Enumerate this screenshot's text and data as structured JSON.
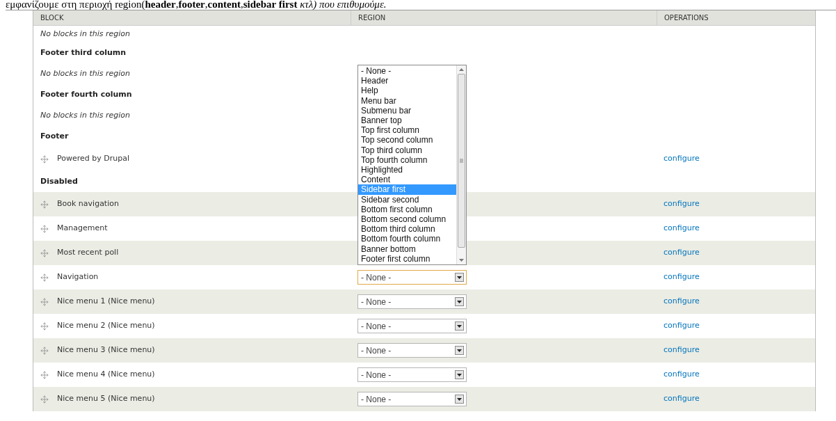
{
  "caption": "εμφανίζουμε στη περιοχή region(**header**,**footer**,**content**,**sidebar first** *κτλ) που επιθυμούμε.*",
  "table": {
    "columns": [
      "BLOCK",
      "REGION",
      "OPERATIONS"
    ],
    "rows": [
      {
        "kind": "empty",
        "text": "No blocks in this region"
      },
      {
        "kind": "region",
        "text": "Footer third column"
      },
      {
        "kind": "empty",
        "text": "No blocks in this region"
      },
      {
        "kind": "region",
        "text": "Footer fourth column"
      },
      {
        "kind": "empty",
        "text": "No blocks in this region"
      },
      {
        "kind": "region",
        "text": "Footer"
      },
      {
        "kind": "block",
        "name": "Powered by Drupal",
        "striped": false,
        "operation": "configure"
      },
      {
        "kind": "region",
        "text": "Disabled"
      },
      {
        "kind": "block",
        "name": "Book navigation",
        "striped": true,
        "operation": "configure"
      },
      {
        "kind": "block",
        "name": "Management",
        "striped": false,
        "operation": "configure"
      },
      {
        "kind": "block",
        "name": "Most recent poll",
        "striped": true,
        "operation": "configure"
      },
      {
        "kind": "block",
        "name": "Navigation",
        "striped": false,
        "region": "- None -",
        "focused": true,
        "operation": "configure",
        "dropdown": [
          {
            "label": "- None -",
            "selected": false
          },
          {
            "label": "Header",
            "selected": false
          },
          {
            "label": "Help",
            "selected": false
          },
          {
            "label": "Menu bar",
            "selected": false
          },
          {
            "label": "Submenu bar",
            "selected": false
          },
          {
            "label": "Banner top",
            "selected": false
          },
          {
            "label": "Top first column",
            "selected": false
          },
          {
            "label": "Top second column",
            "selected": false
          },
          {
            "label": "Top third column",
            "selected": false
          },
          {
            "label": "Top fourth column",
            "selected": false
          },
          {
            "label": "Highlighted",
            "selected": false
          },
          {
            "label": "Content",
            "selected": false
          },
          {
            "label": "Sidebar first",
            "selected": true
          },
          {
            "label": "Sidebar second",
            "selected": false
          },
          {
            "label": "Bottom first column",
            "selected": false
          },
          {
            "label": "Bottom second column",
            "selected": false
          },
          {
            "label": "Bottom third column",
            "selected": false
          },
          {
            "label": "Bottom fourth column",
            "selected": false
          },
          {
            "label": "Banner bottom",
            "selected": false
          },
          {
            "label": "Footer first column",
            "selected": false
          }
        ]
      },
      {
        "kind": "block",
        "name": "Nice menu 1 (Nice menu)",
        "striped": true,
        "region": "- None -",
        "focused": false,
        "operation": "configure"
      },
      {
        "kind": "block",
        "name": "Nice menu 2 (Nice menu)",
        "striped": false,
        "region": "- None -",
        "focused": false,
        "operation": "configure"
      },
      {
        "kind": "block",
        "name": "Nice menu 3 (Nice menu)",
        "striped": true,
        "region": "- None -",
        "focused": false,
        "operation": "configure"
      },
      {
        "kind": "block",
        "name": "Nice menu 4 (Nice menu)",
        "striped": false,
        "region": "- None -",
        "focused": false,
        "operation": "configure"
      },
      {
        "kind": "block",
        "name": "Nice menu 5 (Nice menu)",
        "striped": true,
        "region": "- None -",
        "focused": false,
        "operation": "configure"
      }
    ]
  }
}
